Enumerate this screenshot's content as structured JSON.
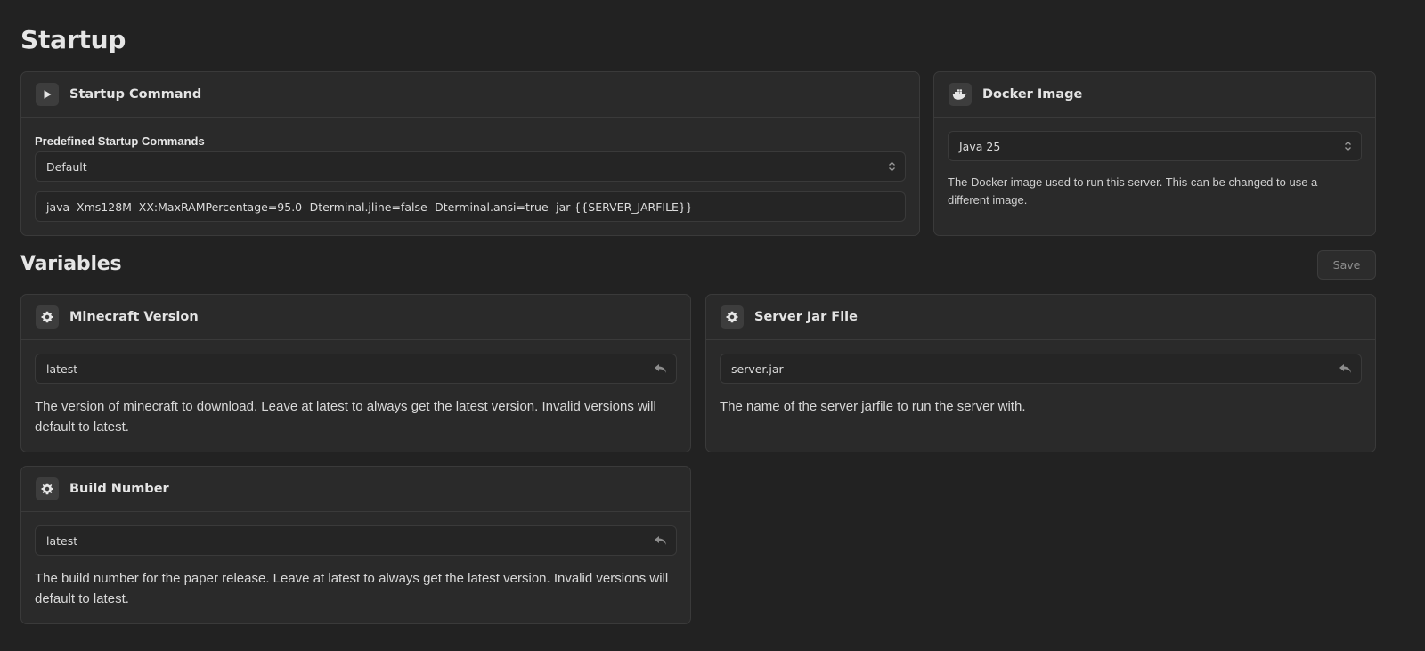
{
  "page": {
    "startup_title": "Startup",
    "variables_title": "Variables",
    "save_label": "Save"
  },
  "startup_command": {
    "title": "Startup Command",
    "icon": "play-icon",
    "predefined_label": "Predefined Startup Commands",
    "selected": "Default",
    "command": "java -Xms128M -XX:MaxRAMPercentage=95.0 -Dterminal.jline=false -Dterminal.ansi=true -jar {{SERVER_JARFILE}}"
  },
  "docker_image": {
    "title": "Docker Image",
    "icon": "docker-icon",
    "selected": "Java 25",
    "description": "The Docker image used to run this server. This can be changed to use a different image."
  },
  "variables": [
    {
      "title": "Minecraft Version",
      "icon": "gear-icon",
      "value": "latest",
      "description": "The version of minecraft to download. Leave at latest to always get the latest version. Invalid versions will default to latest."
    },
    {
      "title": "Server Jar File",
      "icon": "gear-icon",
      "value": "server.jar",
      "description": "The name of the server jarfile to run the server with."
    },
    {
      "title": "Build Number",
      "icon": "gear-icon",
      "value": "latest",
      "description": "The build number for the paper release. Leave at latest to always get the latest version. Invalid versions will default to latest."
    }
  ],
  "colors": {
    "background": "#222222",
    "card": "#2a2a2a",
    "border": "#3a3a3a",
    "text": "#e8e8e8"
  }
}
